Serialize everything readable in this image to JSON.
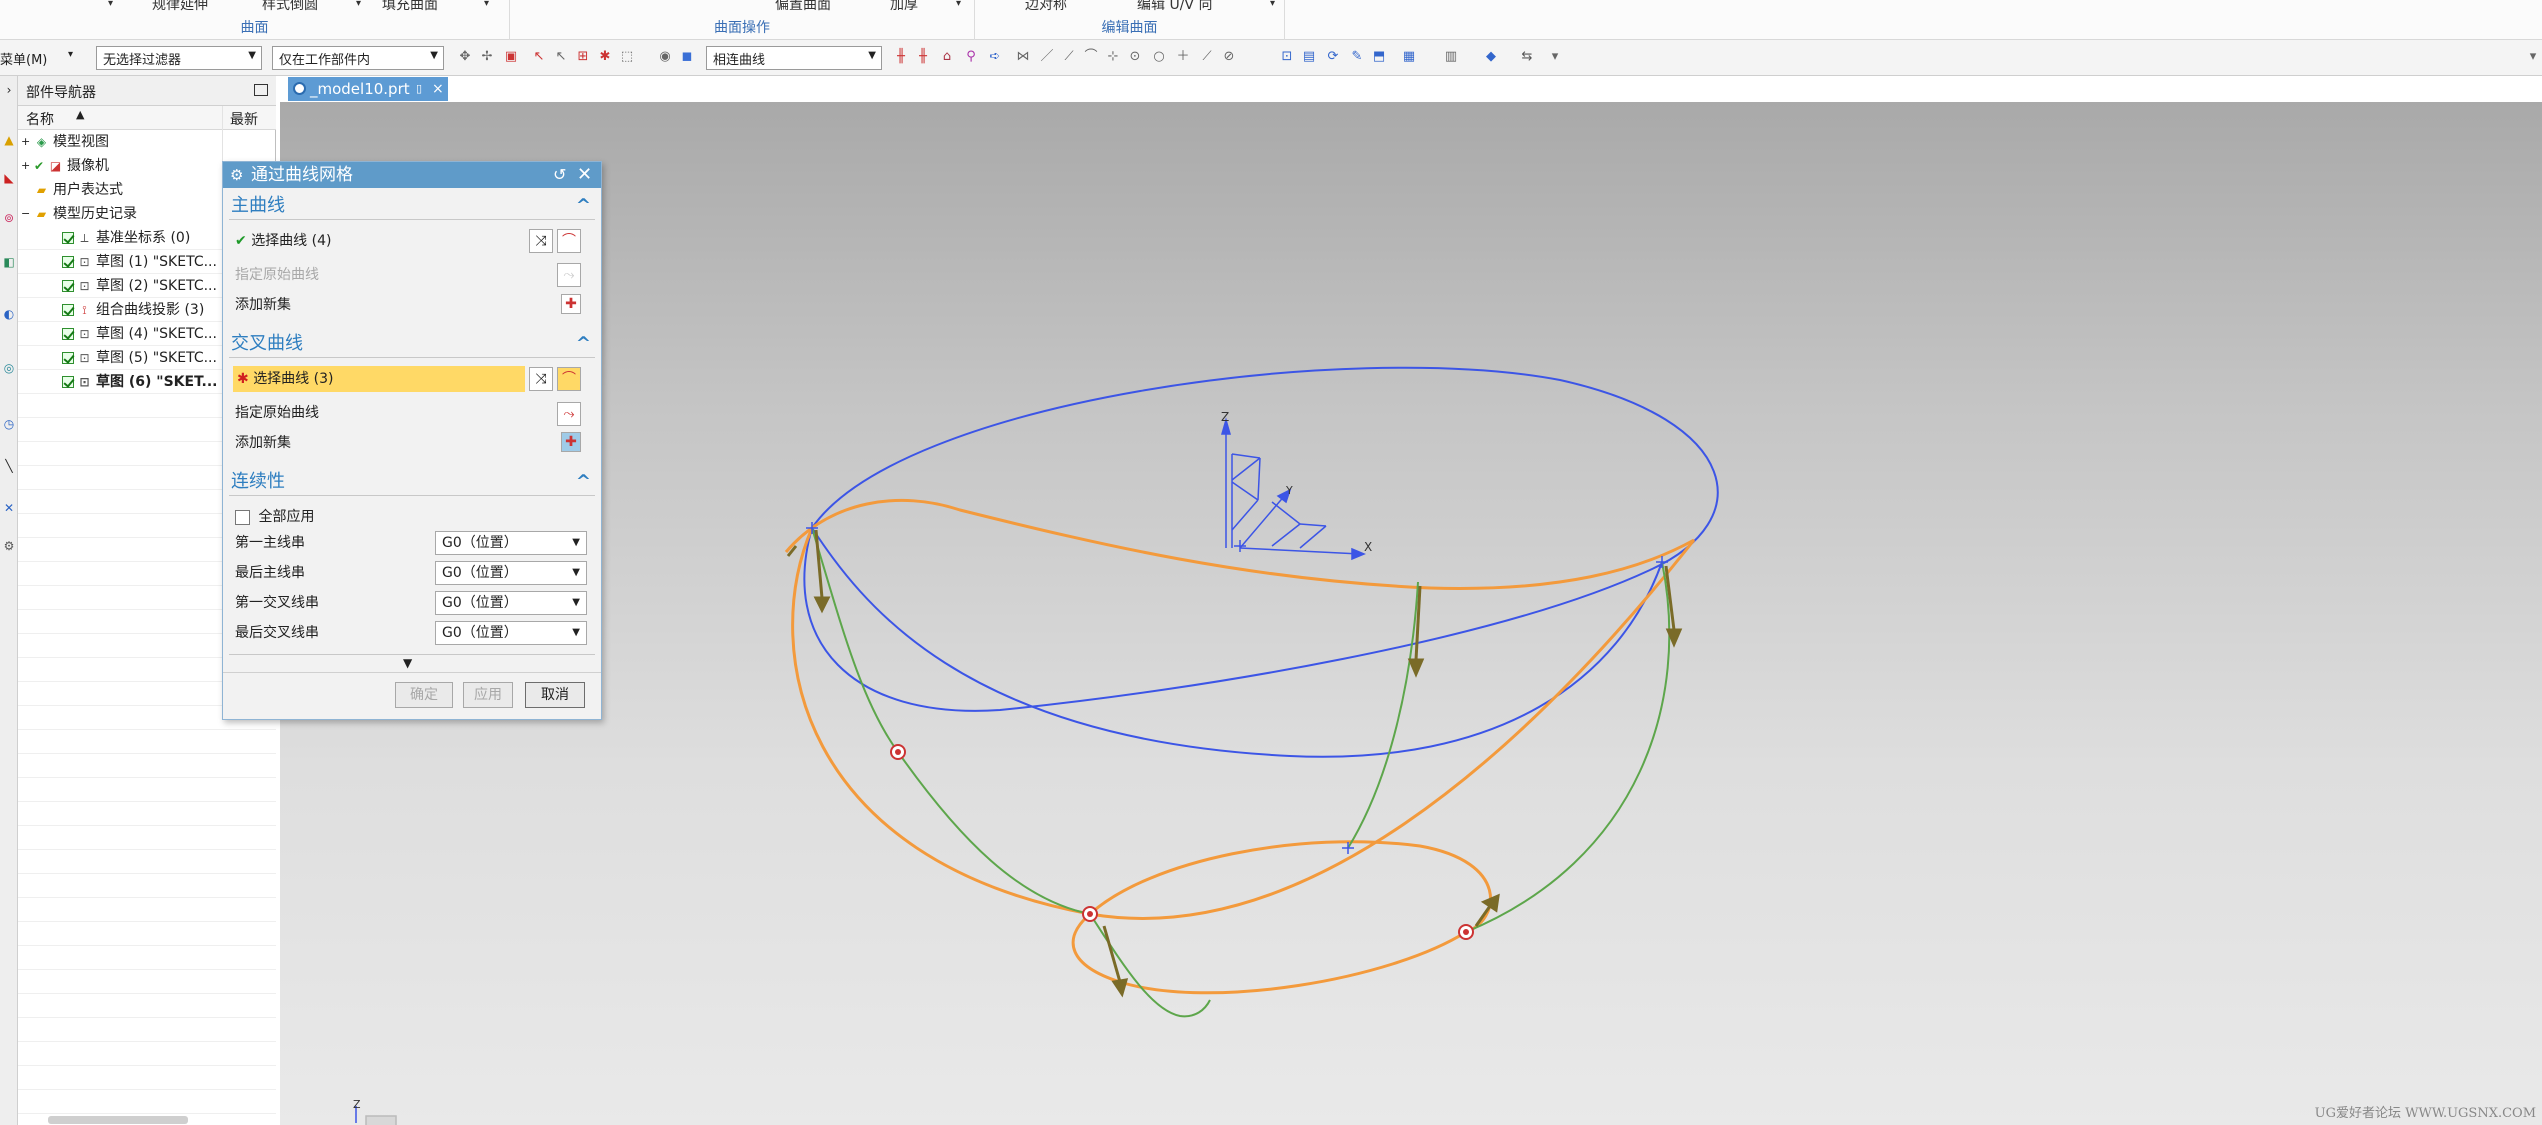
{
  "ribbon": {
    "groups": [
      {
        "label": "曲面",
        "buttons": [
          "规律延伸",
          "样式倒圆"
        ]
      },
      {
        "label": "",
        "buttons": [
          "填充曲面"
        ]
      },
      {
        "label": "曲面操作",
        "buttons": [
          "偏置曲面",
          "加厚"
        ]
      },
      {
        "label": "编辑曲面",
        "buttons": [
          "边对称",
          "编辑 U/V 向"
        ]
      }
    ]
  },
  "toolbar": {
    "menu_label": "菜单(M)",
    "filter_value": "无选择过滤器",
    "scope_value": "仅在工作部件内",
    "curve_rule_value": "相连曲线"
  },
  "navigator": {
    "title": "部件导航器",
    "col_name": "名称",
    "col_latest": "最新",
    "items": [
      {
        "label": "模型视图",
        "icon": "model-views-icon"
      },
      {
        "label": "摄像机",
        "icon": "camera-icon"
      },
      {
        "label": "用户表达式",
        "icon": "folder-icon"
      },
      {
        "label": "模型历史记录",
        "icon": "folder-open-icon"
      },
      {
        "label": "基准坐标系 (0)",
        "icon": "datum-csys-icon"
      },
      {
        "label": "草图 (1) \"SKETC...",
        "icon": "sketch-icon"
      },
      {
        "label": "草图 (2) \"SKETC...",
        "icon": "sketch-icon"
      },
      {
        "label": "组合曲线投影 (3)",
        "icon": "combined-projection-icon"
      },
      {
        "label": "草图 (4) \"SKETC...",
        "icon": "sketch-icon"
      },
      {
        "label": "草图 (5) \"SKETC...",
        "icon": "sketch-icon"
      },
      {
        "label": "草图 (6) \"SKET...",
        "icon": "sketch-icon"
      }
    ]
  },
  "tab": {
    "label": "_model10.prt"
  },
  "dialog": {
    "title": "通过曲线网格",
    "primary": {
      "heading": "主曲线",
      "select_label": "选择曲线 (4)",
      "origin_label": "指定原始曲线",
      "add_label": "添加新集"
    },
    "cross": {
      "heading": "交叉曲线",
      "select_label": "选择曲线 (3)",
      "origin_label": "指定原始曲线",
      "add_label": "添加新集"
    },
    "continuity": {
      "heading": "连续性",
      "apply_all_label": "全部应用",
      "rows": [
        {
          "label": "第一主线串",
          "value": "G0（位置）"
        },
        {
          "label": "最后主线串",
          "value": "G0（位置）"
        },
        {
          "label": "第一交叉线串",
          "value": "G0（位置）"
        },
        {
          "label": "最后交叉线串",
          "value": "G0（位置）"
        }
      ]
    },
    "buttons": {
      "ok": "确定",
      "apply": "应用",
      "cancel": "取消"
    }
  },
  "viewport": {
    "axis_labels": {
      "x": "X",
      "y": "Y",
      "z": "Z"
    },
    "watermark": "UG爱好者论坛 WWW.UGSNX.COM"
  },
  "colors": {
    "accent": "#5f9bc9",
    "section_heading": "#2e7ec0",
    "highlight_row": "#ffd966",
    "curve_blue": "#3c55e6",
    "curve_orange": "#f39a3c",
    "curve_green": "#5da64b"
  }
}
